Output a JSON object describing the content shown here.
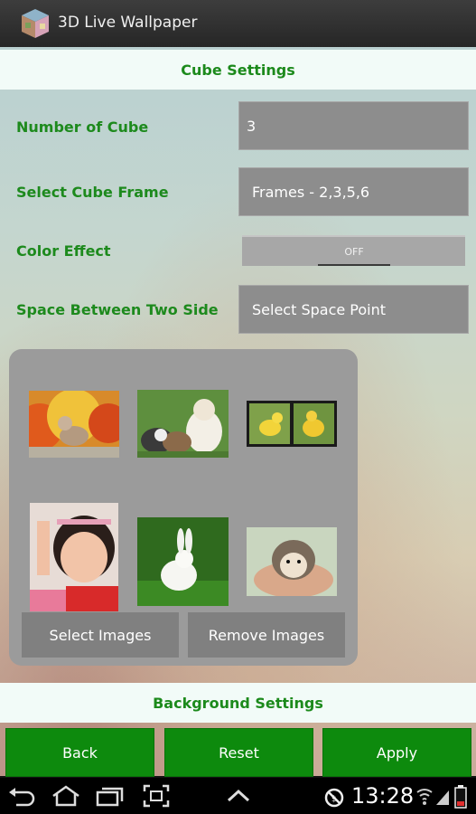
{
  "app": {
    "title": "3D Live Wallpaper"
  },
  "cube_settings": {
    "header": "Cube Settings",
    "number_of_cube": {
      "label": "Number of Cube",
      "value": "3"
    },
    "cube_frame": {
      "label": "Select Cube Frame",
      "value": "Frames - 2,3,5,6"
    },
    "color_effect": {
      "label": "Color Effect",
      "state": "OFF"
    },
    "space_between": {
      "label": "Space Between Two Side",
      "value": "Select Space Point"
    }
  },
  "images_panel": {
    "thumbnails": [
      {
        "name": "bird-on-fruit"
      },
      {
        "name": "puppies"
      },
      {
        "name": "chicks"
      },
      {
        "name": "baby-girl"
      },
      {
        "name": "white-rabbit"
      },
      {
        "name": "hedgehog-in-hand"
      }
    ],
    "select_label": "Select Images",
    "remove_label": "Remove Images"
  },
  "background_settings": {
    "header": "Background Settings"
  },
  "footer": {
    "back": "Back",
    "reset": "Reset",
    "apply": "Apply"
  },
  "status_bar": {
    "time": "13:28"
  },
  "colors": {
    "accent_green": "#0d8a0d",
    "label_green": "#1d8a1d"
  }
}
